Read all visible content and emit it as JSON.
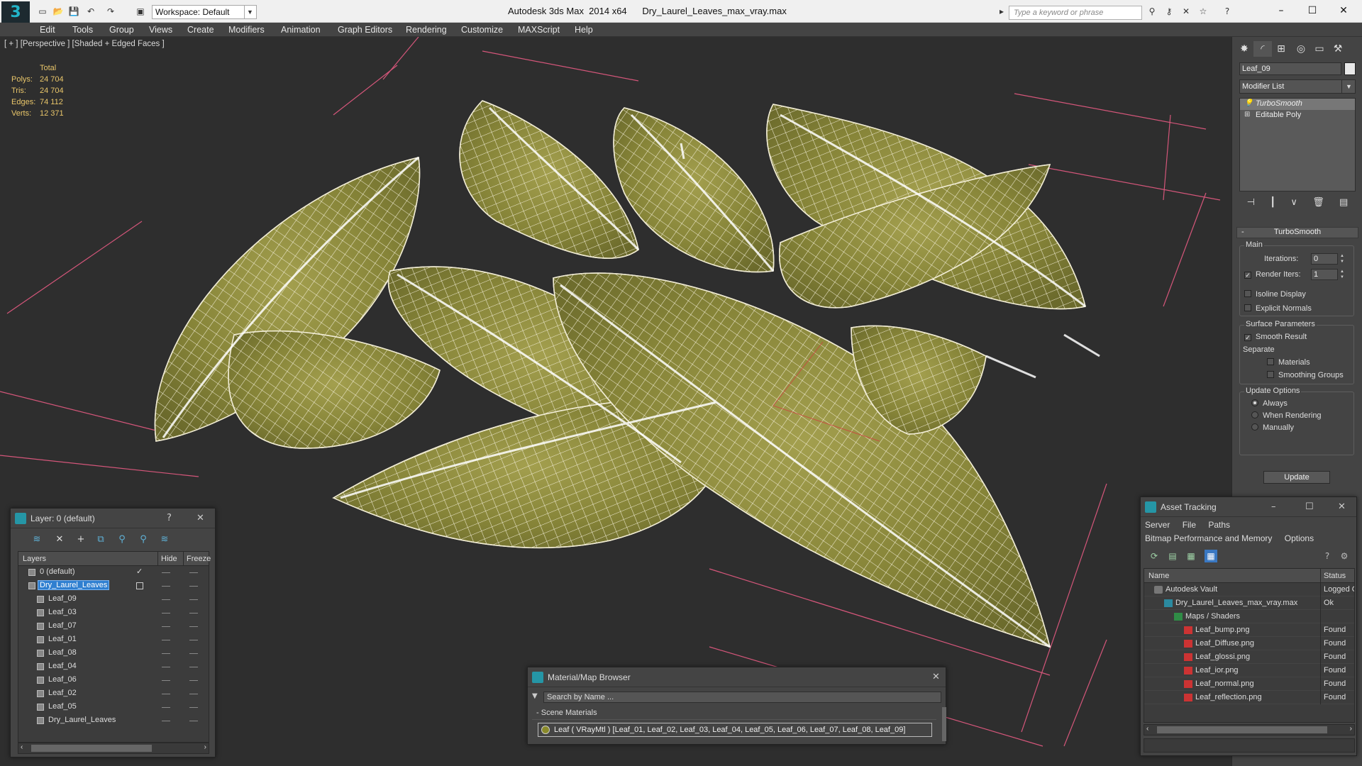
{
  "titlebar": {
    "workspace_label": "Workspace: Default",
    "window_title": "Autodesk 3ds Max  2014 x64      Dry_Laurel_Leaves_max_vray.max",
    "search_placeholder": "Type a keyword or phrase",
    "logo_glyph": "3"
  },
  "menu": [
    "Edit",
    "Tools",
    "Group",
    "Views",
    "Create",
    "Modifiers",
    "Animation",
    "Graph Editors",
    "Rendering",
    "Customize",
    "MAXScript",
    "Help"
  ],
  "viewport": {
    "label": "[ + ] [Perspective ] [Shaded + Edged Faces ]",
    "stats": {
      "header": "Total",
      "rows": [
        {
          "k": "Polys:",
          "v": "24 704"
        },
        {
          "k": "Tris:",
          "v": "24 704"
        },
        {
          "k": "Edges:",
          "v": "74 112"
        },
        {
          "k": "Verts:",
          "v": "12 371"
        }
      ]
    },
    "colors": {
      "grid": "#d4567a",
      "leaf_base": "#8b8a3a",
      "wire": "#f1ecd4",
      "stats": "#e9c66a"
    }
  },
  "command_panel": {
    "object_name": "Leaf_09",
    "modifier_list": "Modifier List",
    "stack": [
      "TurboSmooth",
      "Editable Poly"
    ],
    "turbosmooth": {
      "title": "TurboSmooth",
      "main_title": "Main",
      "iterations_label": "Iterations:",
      "iterations_value": "0",
      "render_iters_label": "Render Iters:",
      "render_iters_value": "1",
      "isoline": "Isoline Display",
      "explicit": "Explicit Normals",
      "surface_title": "Surface Parameters",
      "smooth_result": "Smooth Result",
      "separate": "Separate",
      "materials": "Materials",
      "smoothing_groups": "Smoothing Groups",
      "update_title": "Update Options",
      "always": "Always",
      "when_rendering": "When Rendering",
      "manually": "Manually",
      "update_btn": "Update"
    }
  },
  "layer_panel": {
    "title": "Layer: 0 (default)",
    "help": "?",
    "col_layers": "Layers",
    "col_hide": "Hide",
    "col_freeze": "Freeze",
    "rows": [
      {
        "name": "0 (default)",
        "indent": 1
      },
      {
        "name": "Dry_Laurel_Leaves",
        "indent": 1
      },
      {
        "name": "Leaf_09",
        "indent": 2
      },
      {
        "name": "Leaf_03",
        "indent": 2
      },
      {
        "name": "Leaf_07",
        "indent": 2
      },
      {
        "name": "Leaf_01",
        "indent": 2
      },
      {
        "name": "Leaf_08",
        "indent": 2
      },
      {
        "name": "Leaf_04",
        "indent": 2
      },
      {
        "name": "Leaf_06",
        "indent": 2
      },
      {
        "name": "Leaf_02",
        "indent": 2
      },
      {
        "name": "Leaf_05",
        "indent": 2
      },
      {
        "name": "Dry_Laurel_Leaves",
        "indent": 2
      }
    ]
  },
  "material_browser": {
    "title": "Material/Map Browser",
    "search_placeholder": "Search by Name ...",
    "section": "Scene Materials",
    "item": "Leaf  ( VRayMtl )  [Leaf_01, Leaf_02, Leaf_03, Leaf_04, Leaf_05, Leaf_06, Leaf_07, Leaf_08, Leaf_09]"
  },
  "asset_tracking": {
    "title": "Asset Tracking",
    "menu1": [
      "Server",
      "File",
      "Paths"
    ],
    "menu2": [
      "Bitmap Performance and Memory",
      "Options"
    ],
    "col_name": "Name",
    "col_status": "Status",
    "rows": [
      {
        "name": "Autodesk Vault",
        "status": "Logged O",
        "indent": 1,
        "icon": "vault"
      },
      {
        "name": "Dry_Laurel_Leaves_max_vray.max",
        "status": "Ok",
        "indent": 2,
        "icon": "max"
      },
      {
        "name": "Maps / Shaders",
        "status": "",
        "indent": 3,
        "icon": "folder"
      },
      {
        "name": "Leaf_bump.png",
        "status": "Found",
        "indent": 4,
        "icon": "png"
      },
      {
        "name": "Leaf_Diffuse.png",
        "status": "Found",
        "indent": 4,
        "icon": "png"
      },
      {
        "name": "Leaf_glossi.png",
        "status": "Found",
        "indent": 4,
        "icon": "png"
      },
      {
        "name": "Leaf_ior.png",
        "status": "Found",
        "indent": 4,
        "icon": "png"
      },
      {
        "name": "Leaf_normal.png",
        "status": "Found",
        "indent": 4,
        "icon": "png"
      },
      {
        "name": "Leaf_reflection.png",
        "status": "Found",
        "indent": 4,
        "icon": "png"
      }
    ]
  }
}
